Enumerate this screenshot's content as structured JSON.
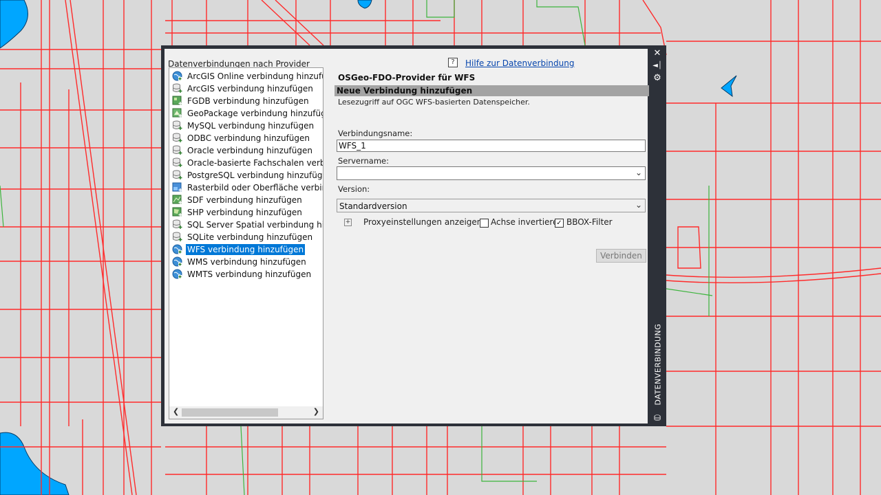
{
  "panel": {
    "title": "DATENVERBINDUNG",
    "providers_header": "Datenverbindungen nach Provider",
    "help_link": "Hilfe zur Datenverbindung",
    "help_icon_glyph": "?"
  },
  "providers": [
    {
      "label": "ArcGIS Online verbindung hinzufügen",
      "icon": "globe-icon"
    },
    {
      "label": "ArcGIS verbindung hinzufügen",
      "icon": "database-icon"
    },
    {
      "label": "FGDB verbindung hinzufügen",
      "icon": "fgdb-icon"
    },
    {
      "label": "GeoPackage verbindung hinzufügen",
      "icon": "geopackage-icon"
    },
    {
      "label": "MySQL verbindung hinzufügen",
      "icon": "database-icon"
    },
    {
      "label": "ODBC verbindung hinzufügen",
      "icon": "database-icon"
    },
    {
      "label": "Oracle verbindung hinzufügen",
      "icon": "database-icon"
    },
    {
      "label": "Oracle-basierte Fachschalen verbindung hinzufügen",
      "icon": "database-icon"
    },
    {
      "label": "PostgreSQL verbindung hinzufügen",
      "icon": "database-icon"
    },
    {
      "label": "Rasterbild oder Oberfläche verbindung hinzufügen",
      "icon": "raster-icon"
    },
    {
      "label": "SDF verbindung hinzufügen",
      "icon": "sdf-icon"
    },
    {
      "label": "SHP verbindung hinzufügen",
      "icon": "shp-icon"
    },
    {
      "label": "SQL Server Spatial verbindung hinzufügen",
      "icon": "database-icon"
    },
    {
      "label": "SQLite verbindung hinzufügen",
      "icon": "database-icon"
    },
    {
      "label": "WFS verbindung hinzufügen",
      "icon": "globe-icon",
      "selected": true
    },
    {
      "label": "WMS verbindung hinzufügen",
      "icon": "globe-icon"
    },
    {
      "label": "WMTS verbindung hinzufügen",
      "icon": "globe-icon"
    }
  ],
  "form": {
    "provider_title": "OSGeo-FDO-Provider für WFS",
    "section_title": "Neue Verbindung hinzufügen",
    "description": "Lesezugriff auf OGC WFS-basierten Datenspeicher.",
    "connection_name_label": "Verbindungsname:",
    "connection_name_value": "WFS_1",
    "server_name_label": "Servername:",
    "server_name_value": "",
    "version_label": "Version:",
    "version_value": "Standardversion",
    "proxy_label": "Proxyeinstellungen anzeigen",
    "invert_axis_label": "Achse invertieren",
    "invert_axis_checked": false,
    "bbox_filter_label": "BBOX-Filter",
    "bbox_filter_checked": true,
    "connect_label": "Verbinden"
  },
  "colors": {
    "map_background": "#d9d9d9",
    "road": "#ff2a2a",
    "parcel": "#3cb43c",
    "water": "#00a6ff",
    "selection": "#0078d7",
    "palette_frame": "#2d3139"
  }
}
